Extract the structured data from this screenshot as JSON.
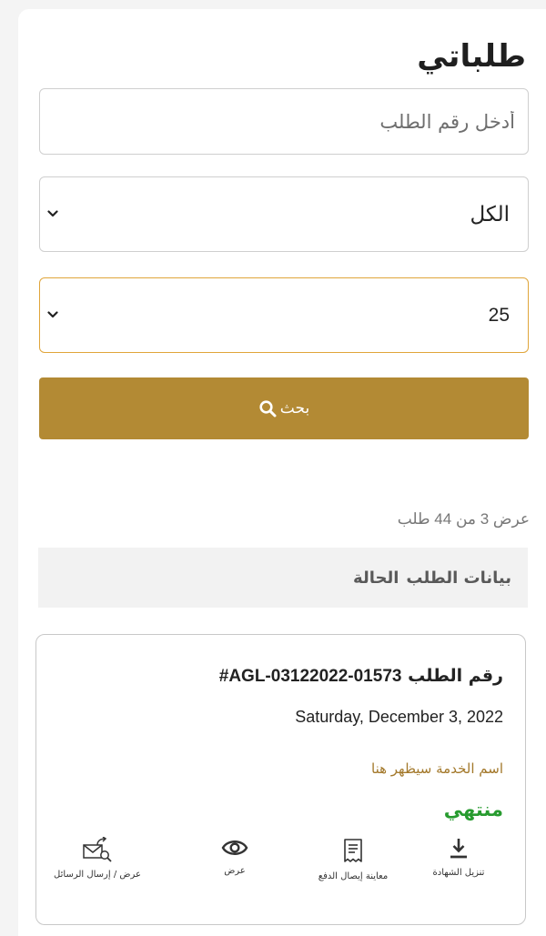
{
  "page": {
    "title": "طلباتي"
  },
  "search": {
    "placeholder": "أدخل رقم الطلب"
  },
  "filters": {
    "status_selected": "الكل",
    "page_size_selected": "25"
  },
  "search_button": {
    "label": "بحث",
    "icon": "search-icon"
  },
  "results": {
    "count_text": "عرض 3 من 44 طلب"
  },
  "table_header": {
    "col_request_data": "بيانات الطلب",
    "col_status": "الحالة"
  },
  "request_card": {
    "number_label": "رقم الطلب",
    "number_value": "#AGL-03122022-01573",
    "date": "Saturday, December 3, 2022",
    "service_name": "اسم الخدمة سيظهر هنا",
    "status": "منتهي",
    "actions": [
      {
        "label": "تنزيل الشهادة",
        "icon": "download-icon"
      },
      {
        "label": "معاينة إيصال الدفع",
        "icon": "receipt-icon"
      },
      {
        "label": "عرض",
        "icon": "eye-icon"
      },
      {
        "label": "عرض / إرسال الرسائل",
        "icon": "messages-icon"
      }
    ]
  },
  "colors": {
    "accent": "#b38a34",
    "focus_border": "#e0a53a",
    "status_complete": "#279b2f",
    "service_text": "#a3782a"
  }
}
